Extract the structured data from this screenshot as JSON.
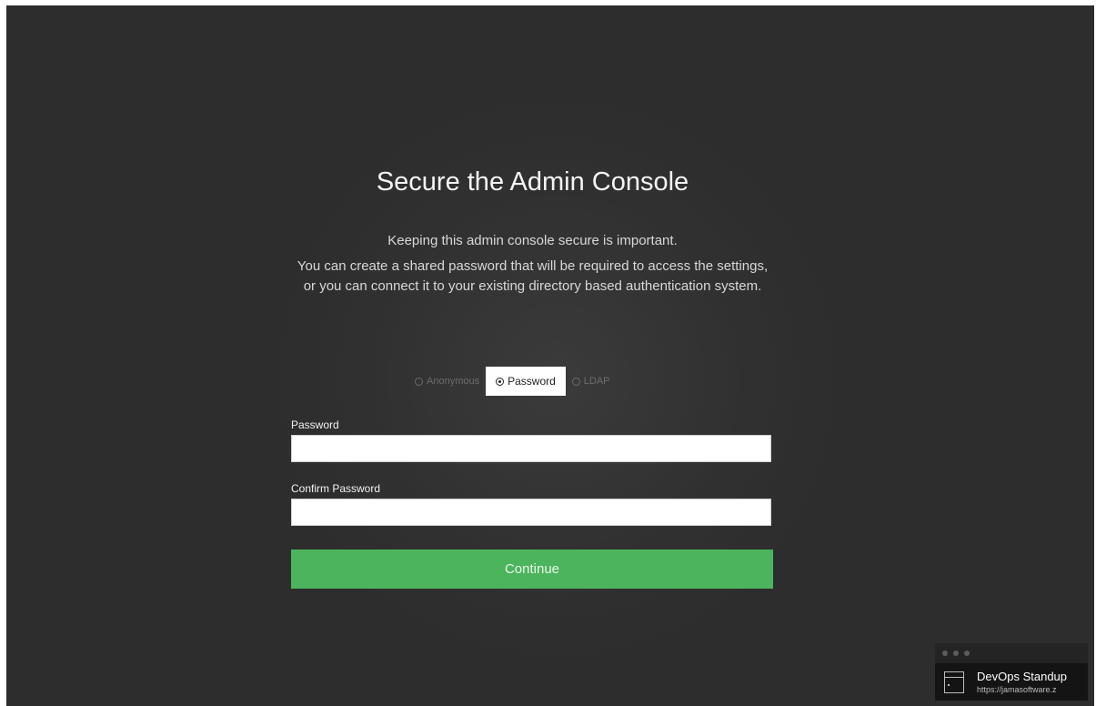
{
  "page": {
    "title": "Secure the Admin Console",
    "intro": "Keeping this admin console secure is important.",
    "description": "You can create a shared password that will be required to access the settings, or you can connect it to your existing directory based authentication system."
  },
  "auth_options": [
    {
      "label": "Anonymous",
      "selected": false
    },
    {
      "label": "Password",
      "selected": true
    },
    {
      "label": "LDAP",
      "selected": false
    }
  ],
  "form": {
    "password_label": "Password",
    "password_value": "",
    "confirm_label": "Confirm Password",
    "confirm_value": "",
    "continue_label": "Continue"
  },
  "notification": {
    "title": "DevOps Standup",
    "url": "https://jamasoftware.z"
  },
  "colors": {
    "background": "#2d2d2d",
    "accent_green": "#4cb45c"
  }
}
